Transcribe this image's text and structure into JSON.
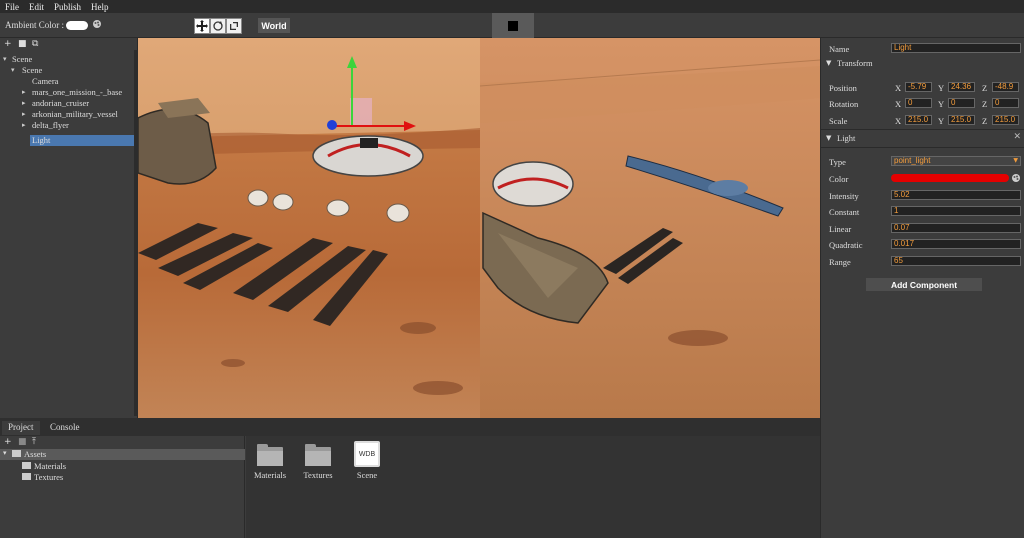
{
  "menu": [
    "File",
    "Edit",
    "Publish",
    "Help"
  ],
  "toolbar": {
    "ambient_label": "Ambient Color :",
    "ambient_color": "#ffffff",
    "space_button": "World"
  },
  "scene_tree": {
    "root": "Scene",
    "child": "Scene",
    "items": [
      {
        "label": "Camera",
        "expandable": false
      },
      {
        "label": "mars_one_mission_-_base",
        "expandable": true
      },
      {
        "label": "andorian_cruiser",
        "expandable": true
      },
      {
        "label": "arkonian_military_vessel",
        "expandable": true
      },
      {
        "label": "delta_flyer",
        "expandable": true
      },
      {
        "label": "Light",
        "expandable": false,
        "selected": true
      }
    ]
  },
  "bottom": {
    "tabs": [
      "Project",
      "Console"
    ],
    "active_tab": "Project",
    "assets_tree": {
      "root": "Assets",
      "children": [
        "Materials",
        "Textures"
      ]
    },
    "files": [
      {
        "label": "Materials",
        "icon": "folder-icon"
      },
      {
        "label": "Textures",
        "icon": "folder-icon"
      },
      {
        "label": "Scene",
        "icon": "wdb-file-icon",
        "badge": "WDB"
      }
    ]
  },
  "inspector": {
    "name_label": "Name",
    "name_value": "Light",
    "transform": {
      "title": "Transform",
      "position_label": "Position",
      "rotation_label": "Rotation",
      "scale_label": "Scale",
      "position": {
        "x": "-5.79",
        "y": "24.36",
        "z": "-48.9"
      },
      "rotation": {
        "x": "0",
        "y": "0",
        "z": "0"
      },
      "scale": {
        "x": "215.0",
        "y": "215.0",
        "z": "215.0"
      },
      "axis_x": "X",
      "axis_y": "Y",
      "axis_z": "Z"
    },
    "light": {
      "title": "Light",
      "type_label": "Type",
      "type_value": "point_light",
      "color_label": "Color",
      "color_value": "#e50000",
      "intensity_label": "Intensity",
      "intensity_value": "5.02",
      "constant_label": "Constant",
      "constant_value": "1",
      "linear_label": "Linear",
      "linear_value": "0.07",
      "quadratic_label": "Quadratic",
      "quadratic_value": "0.017",
      "range_label": "Range",
      "range_value": "65"
    },
    "add_component": "Add Component"
  }
}
